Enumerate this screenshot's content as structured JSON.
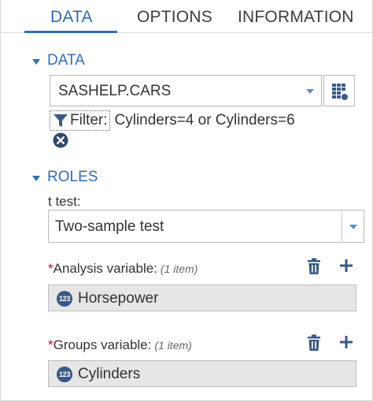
{
  "tabs": [
    {
      "label": "DATA"
    },
    {
      "label": "OPTIONS"
    },
    {
      "label": "INFORMATION"
    }
  ],
  "data_section": {
    "title": "DATA",
    "dataset": "SASHELP.CARS",
    "filter_label": "Filter:",
    "filter_expression": "Cylinders=4 or Cylinders=6"
  },
  "roles_section": {
    "title": "ROLES",
    "t_test_label": "t test:",
    "t_test_value": "Two-sample test",
    "analysis": {
      "required_mark": "*",
      "label": "Analysis variable:",
      "count": "(1 item)",
      "badge": "123",
      "value": "Horsepower"
    },
    "groups": {
      "required_mark": "*",
      "label": "Groups variable:",
      "count": "(1 item)",
      "badge": "123",
      "value": "Cylinders"
    }
  },
  "icons": {
    "filter": "filter-funnel-icon",
    "remove": "remove-filter-icon",
    "dataset_options": "table-options-icon",
    "trash": "trash-icon",
    "add": "plus-icon"
  },
  "colors": {
    "accent": "#2f6fb8",
    "required": "#d0021b",
    "role_box": "#e6e6e6",
    "badge": "#3a5a86"
  }
}
